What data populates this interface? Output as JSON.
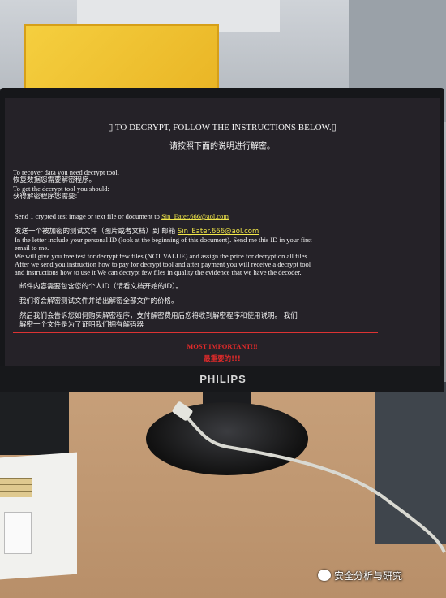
{
  "screen": {
    "heading": "▯  TO DECRYPT, FOLLOW THE INSTRUCTIONS BELOW.▯",
    "heading_zh": "请按照下面的说明进行解密。",
    "lines": [
      "To recover data you need decrypt tool.",
      "恢复数据您需要解密程序。",
      "To get the decrypt tool you should:",
      "获得解密程序您需要:"
    ],
    "send_text": "Send 1 crypted test image or text file or document to",
    "send_zh": "发送一个被加密的测试文件（图片或者文档）到  邮箱",
    "email": "Sin_Eater.666@aol.com",
    "letter_1": "In the letter include your personal ID (look at the beginning of this document). Send me this ID in your first",
    "letter_2": "email to me.",
    "free_1": "We will give you free test for decrypt few files (NOT VALUE) and assign the price for decryption all files.",
    "free_2": "After we send you instruction how to pay for decrypt tool and after payment you will receive a decrypt tool",
    "free_3": "and instructions how to use it We can decrypt few files in quality the evidence that we have the decoder.",
    "zh_1": "邮件内容需要包含您的个人ID（请看文档开始的ID）。",
    "zh_2": "我们将会解密测试文件并给出解密全部文件的价格。",
    "zh_3": "然后我们会告诉您如何购买解密程序，支付解密费用后您将收到解密程序和使用说明。 我们",
    "zh_4": "解密一个文件是为了证明我们拥有解码器",
    "important": "MOST IMPORTANT!!!",
    "important_zh": "最重要的!!!"
  },
  "monitor": {
    "brand": "PHILIPS"
  },
  "watermark": {
    "text": "安全分析与研究"
  }
}
